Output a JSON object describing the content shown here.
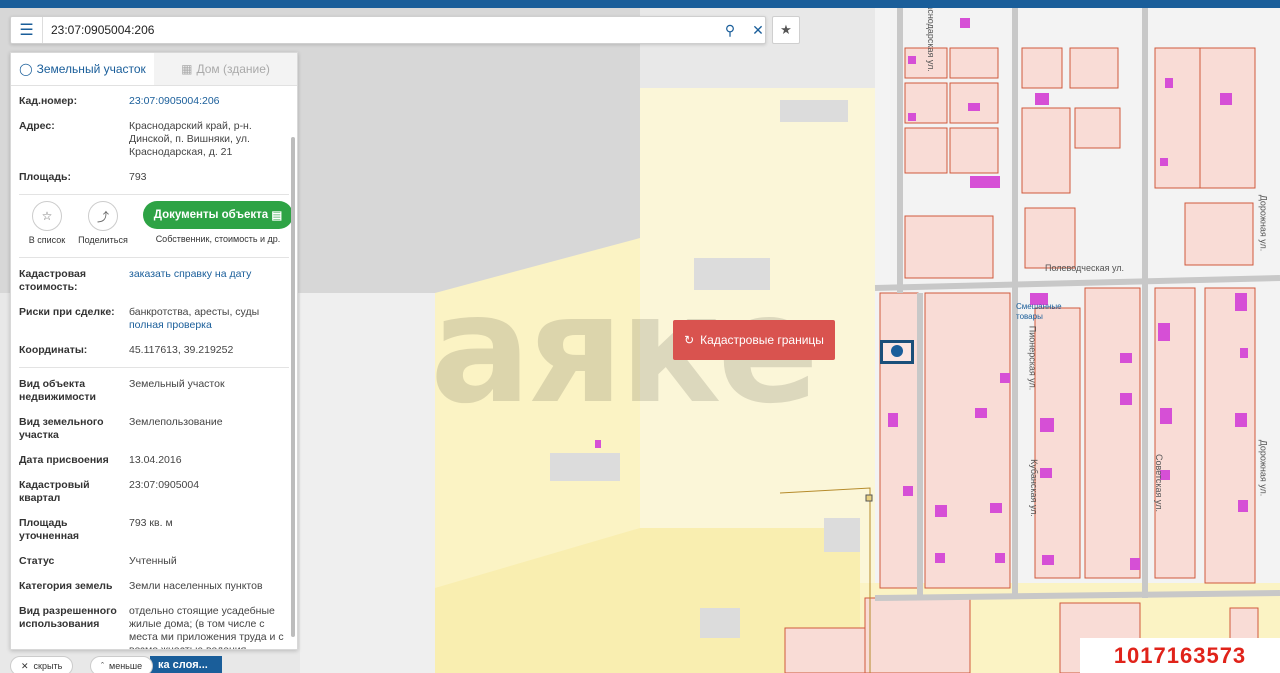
{
  "search": {
    "value": "23:07:0905004:206"
  },
  "tabs": [
    {
      "label": "Земельный участок",
      "icon": "map-pin-icon"
    },
    {
      "label": "Дом (здание)",
      "icon": "building-icon"
    }
  ],
  "details": {
    "cad_label": "Кад.номер:",
    "cad_value": "23:07:0905004:206",
    "address_label": "Адрес:",
    "address_value": "Краснодарский край, р-н. Динской, п. Вишняки, ул. Краснодарская, д. 21",
    "area_label": "Площадь:",
    "area_value": "793"
  },
  "actions": {
    "add_list": "В список",
    "share": "Поделиться",
    "docs_button": "Документы объекта",
    "docs_sub": "Собственник, стоимость и др."
  },
  "details2": {
    "cost_label": "Кадастровая стоимость:",
    "cost_value": "заказать справку на дату",
    "risk_label": "Риски при сделке:",
    "risk_value": "банкротства, аресты, суды",
    "risk_link": "полная проверка",
    "coords_label": "Координаты:",
    "coords_value": "45.117613, 39.219252",
    "type_label": "Вид объекта недвижимости",
    "type_value": "Земельный участок",
    "land_type_label": "Вид земельного участка",
    "land_type_value": "Землепользование",
    "date_label": "Дата присвоения",
    "date_value": "13.04.2016",
    "quarter_label": "Кадастровый квартал",
    "quarter_value": "23:07:0905004",
    "area2_label": "Площадь уточненная",
    "area2_value": "793 кв. м",
    "status_label": "Статус",
    "status_value": "Учтенный",
    "category_label": "Категория земель",
    "category_value": "Земли населенных пунктов",
    "use_label": "Вид разрешенного использования",
    "use_value": "отдельно стоящие усадебные жилые дома; (в том числе с места ми приложения труда и с возмо жностью ведения развитого тов арного личного подсобного хозя йства,сельскохозяйственного п"
  },
  "bottom": {
    "hide": "скрыть",
    "less": "меньше",
    "layers": "ка слоя..."
  },
  "map": {
    "cad_button": "Кадастровые границы",
    "watermark": "аяке",
    "phone": "1017163573",
    "streets": [
      "Краснодарская ул.",
      "Полеводческая ул.",
      "Пионерская ул.",
      "Кубанская ул.",
      "Советская ул.",
      "Дорожная ул.",
      "Смешанные товары",
      "Дорожная ул."
    ],
    "colors": {
      "parcel": "#f9dcd6",
      "parcel_border": "#d05a3c",
      "building": "#d64fd6",
      "zone": "#fbf3c4",
      "accent": "#1a5e9a",
      "cad_button": "#d9534f"
    }
  }
}
